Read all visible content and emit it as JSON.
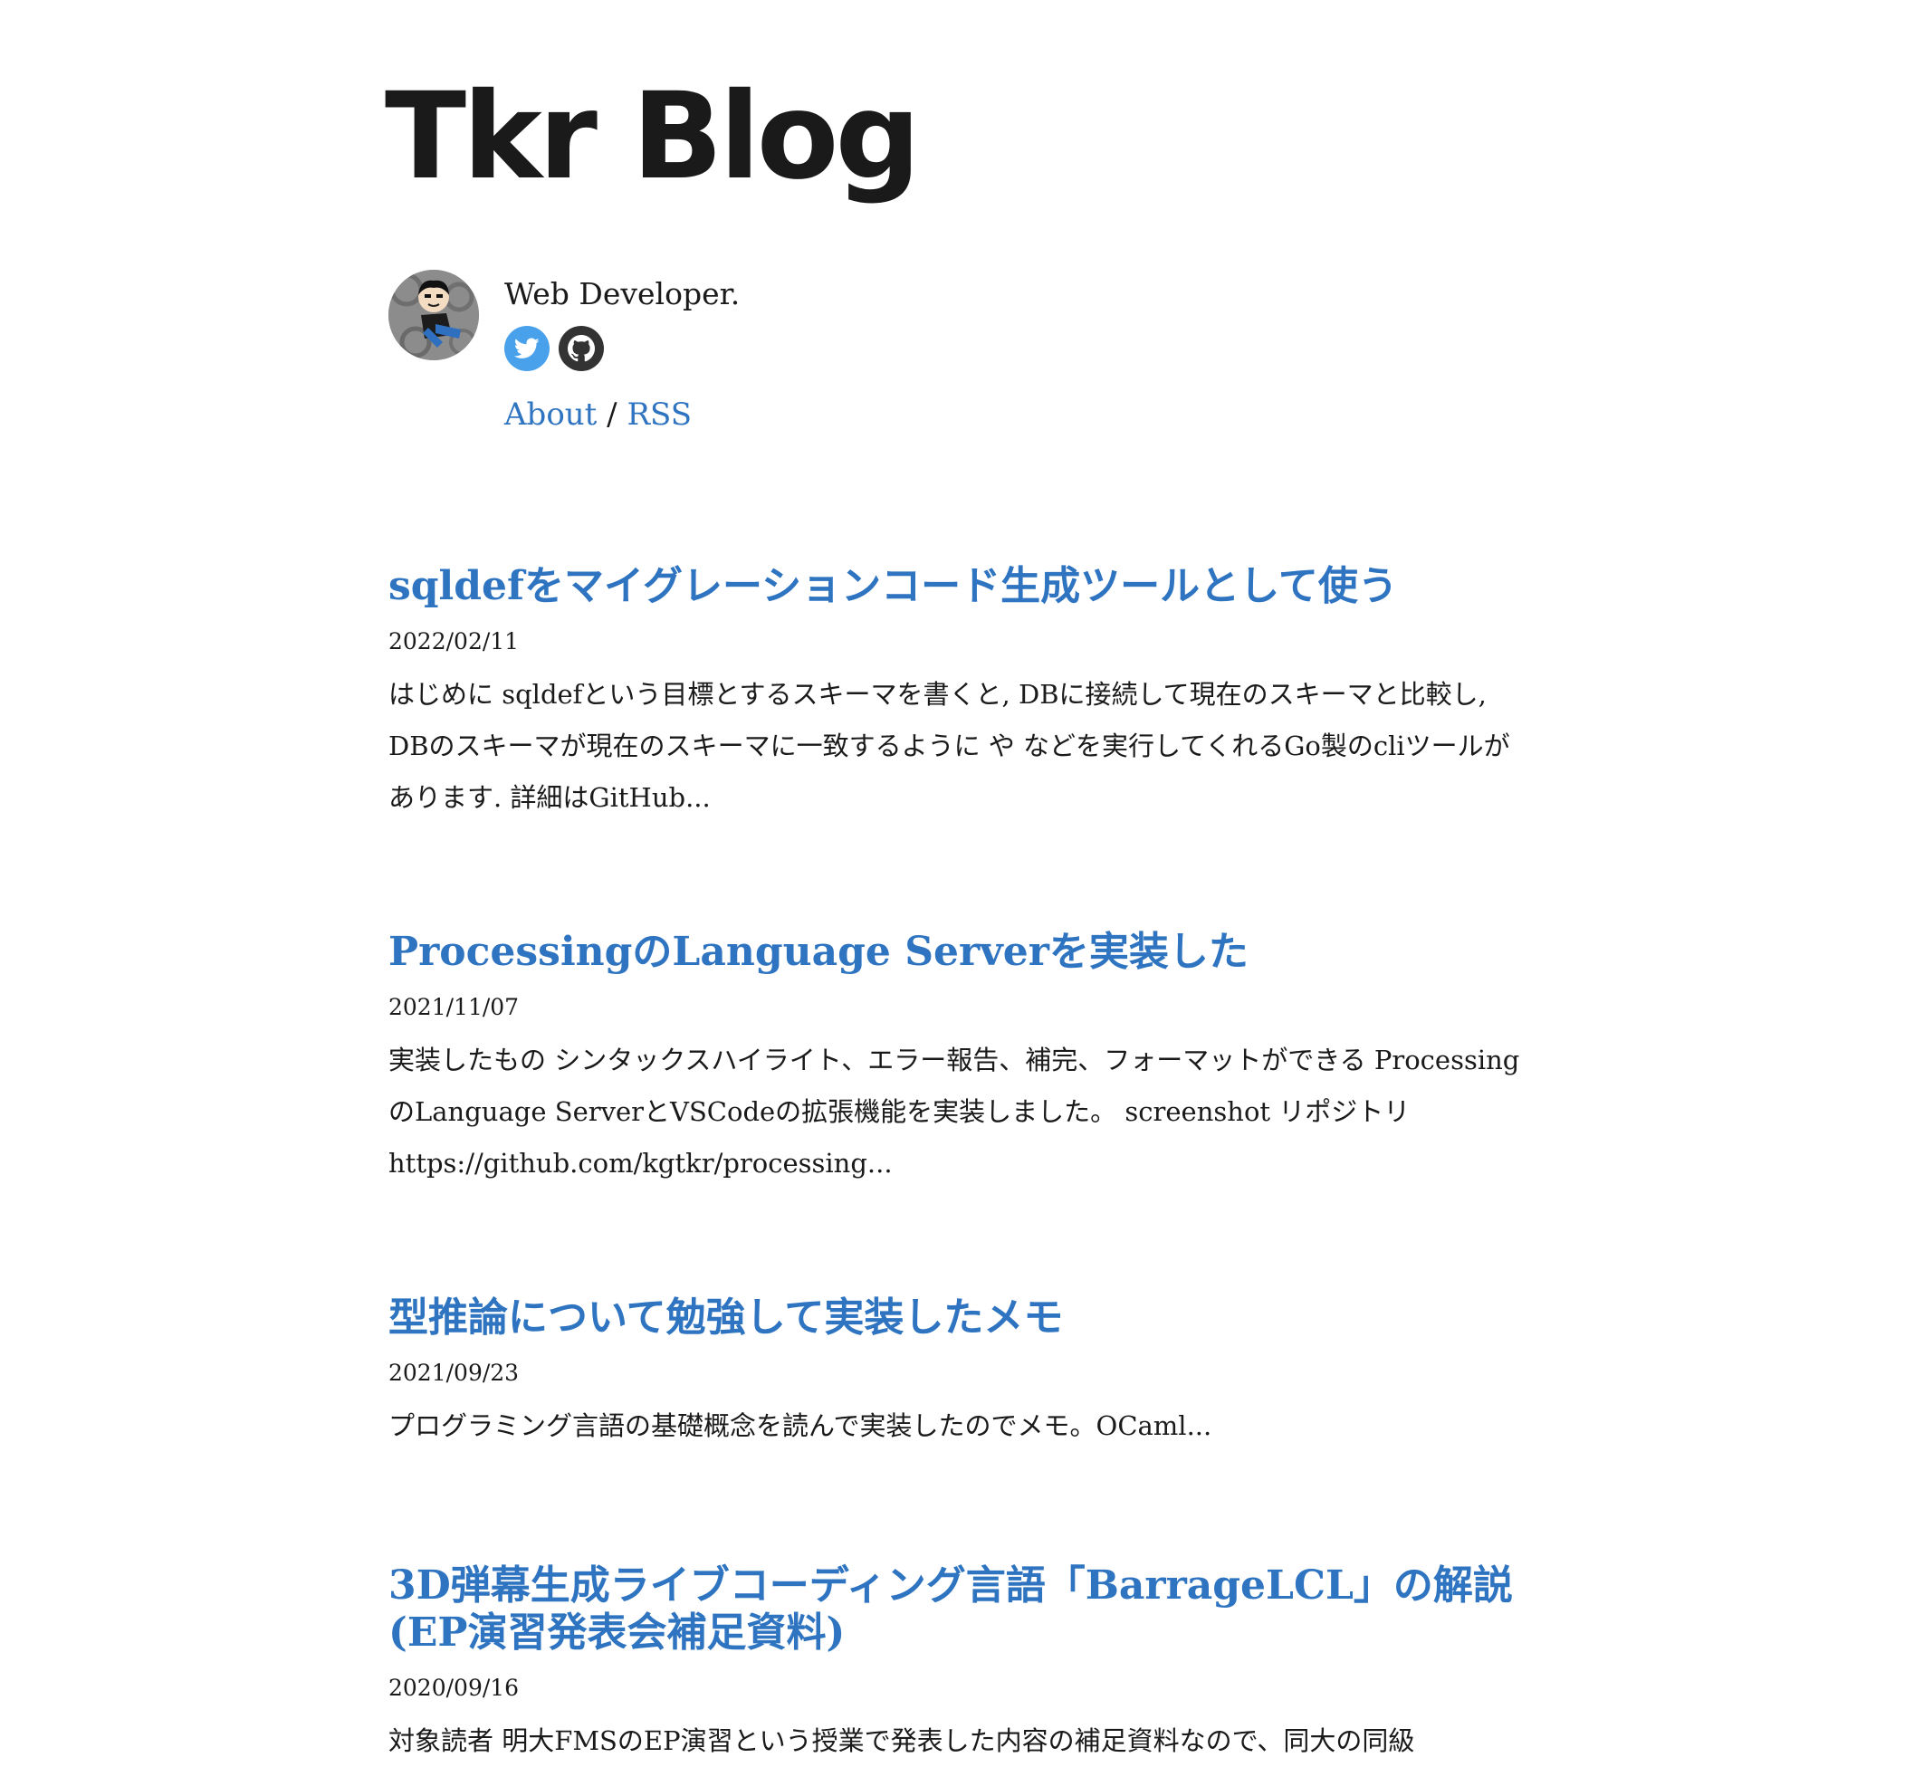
{
  "site": {
    "title": "Tkr Blog"
  },
  "bio": {
    "tagline": "Web Developer.",
    "social": [
      {
        "name": "twitter",
        "icon": "twitter-icon",
        "color": "#4aa1eb"
      },
      {
        "name": "github",
        "icon": "github-icon",
        "color": "#333333"
      }
    ],
    "nav": {
      "about": "About",
      "separator": "/",
      "rss": "RSS"
    }
  },
  "colors": {
    "link": "#2f74c0",
    "text": "#1a1a1a"
  },
  "posts": [
    {
      "title": "sqldefをマイグレーションコード生成ツールとして使う",
      "date": "2022/02/11",
      "excerpt": "はじめに sqldefという目標とするスキーマを書くと, DBに接続して現在のスキーマと比較し, DBのスキーマが現在のスキーマに一致するように や などを実行してくれるGo製のcliツールがあります. 詳細はGitHub..."
    },
    {
      "title": "ProcessingのLanguage Serverを実装した",
      "date": "2021/11/07",
      "excerpt": "実装したもの シンタックスハイライト、エラー報告、補完、フォーマットができる ProcessingのLanguage ServerとVSCodeの拡張機能を実装しました。 screenshot リポジトリ https://github.com/kgtkr/processing..."
    },
    {
      "title": "型推論について勉強して実装したメモ",
      "date": "2021/09/23",
      "excerpt": "プログラミング言語の基礎概念を読んで実装したのでメモ。OCaml..."
    },
    {
      "title": "3D弾幕生成ライブコーディング言語「BarrageLCL」の解説(EP演習発表会補足資料)",
      "date": "2020/09/16",
      "excerpt": "対象読者 明大FMSのEP演習という授業で発表した内容の補足資料なので、同大の同級"
    }
  ]
}
